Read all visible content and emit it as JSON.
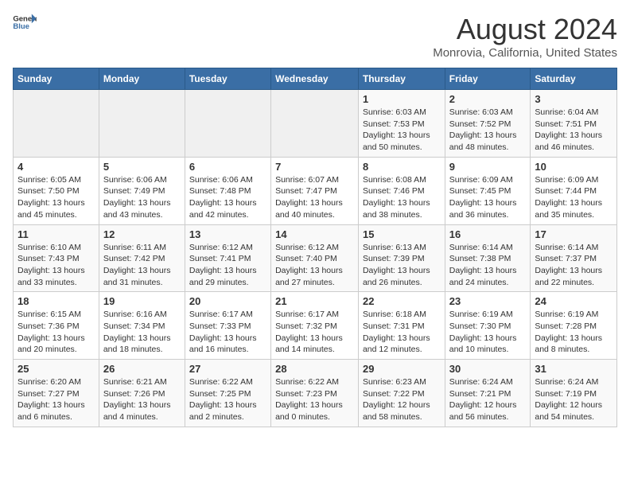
{
  "header": {
    "logo_general": "General",
    "logo_blue": "Blue",
    "month_title": "August 2024",
    "location": "Monrovia, California, United States"
  },
  "calendar": {
    "weekdays": [
      "Sunday",
      "Monday",
      "Tuesday",
      "Wednesday",
      "Thursday",
      "Friday",
      "Saturday"
    ],
    "weeks": [
      [
        {
          "day": "",
          "info": ""
        },
        {
          "day": "",
          "info": ""
        },
        {
          "day": "",
          "info": ""
        },
        {
          "day": "",
          "info": ""
        },
        {
          "day": "1",
          "info": "Sunrise: 6:03 AM\nSunset: 7:53 PM\nDaylight: 13 hours and 50 minutes."
        },
        {
          "day": "2",
          "info": "Sunrise: 6:03 AM\nSunset: 7:52 PM\nDaylight: 13 hours and 48 minutes."
        },
        {
          "day": "3",
          "info": "Sunrise: 6:04 AM\nSunset: 7:51 PM\nDaylight: 13 hours and 46 minutes."
        }
      ],
      [
        {
          "day": "4",
          "info": "Sunrise: 6:05 AM\nSunset: 7:50 PM\nDaylight: 13 hours and 45 minutes."
        },
        {
          "day": "5",
          "info": "Sunrise: 6:06 AM\nSunset: 7:49 PM\nDaylight: 13 hours and 43 minutes."
        },
        {
          "day": "6",
          "info": "Sunrise: 6:06 AM\nSunset: 7:48 PM\nDaylight: 13 hours and 42 minutes."
        },
        {
          "day": "7",
          "info": "Sunrise: 6:07 AM\nSunset: 7:47 PM\nDaylight: 13 hours and 40 minutes."
        },
        {
          "day": "8",
          "info": "Sunrise: 6:08 AM\nSunset: 7:46 PM\nDaylight: 13 hours and 38 minutes."
        },
        {
          "day": "9",
          "info": "Sunrise: 6:09 AM\nSunset: 7:45 PM\nDaylight: 13 hours and 36 minutes."
        },
        {
          "day": "10",
          "info": "Sunrise: 6:09 AM\nSunset: 7:44 PM\nDaylight: 13 hours and 35 minutes."
        }
      ],
      [
        {
          "day": "11",
          "info": "Sunrise: 6:10 AM\nSunset: 7:43 PM\nDaylight: 13 hours and 33 minutes."
        },
        {
          "day": "12",
          "info": "Sunrise: 6:11 AM\nSunset: 7:42 PM\nDaylight: 13 hours and 31 minutes."
        },
        {
          "day": "13",
          "info": "Sunrise: 6:12 AM\nSunset: 7:41 PM\nDaylight: 13 hours and 29 minutes."
        },
        {
          "day": "14",
          "info": "Sunrise: 6:12 AM\nSunset: 7:40 PM\nDaylight: 13 hours and 27 minutes."
        },
        {
          "day": "15",
          "info": "Sunrise: 6:13 AM\nSunset: 7:39 PM\nDaylight: 13 hours and 26 minutes."
        },
        {
          "day": "16",
          "info": "Sunrise: 6:14 AM\nSunset: 7:38 PM\nDaylight: 13 hours and 24 minutes."
        },
        {
          "day": "17",
          "info": "Sunrise: 6:14 AM\nSunset: 7:37 PM\nDaylight: 13 hours and 22 minutes."
        }
      ],
      [
        {
          "day": "18",
          "info": "Sunrise: 6:15 AM\nSunset: 7:36 PM\nDaylight: 13 hours and 20 minutes."
        },
        {
          "day": "19",
          "info": "Sunrise: 6:16 AM\nSunset: 7:34 PM\nDaylight: 13 hours and 18 minutes."
        },
        {
          "day": "20",
          "info": "Sunrise: 6:17 AM\nSunset: 7:33 PM\nDaylight: 13 hours and 16 minutes."
        },
        {
          "day": "21",
          "info": "Sunrise: 6:17 AM\nSunset: 7:32 PM\nDaylight: 13 hours and 14 minutes."
        },
        {
          "day": "22",
          "info": "Sunrise: 6:18 AM\nSunset: 7:31 PM\nDaylight: 13 hours and 12 minutes."
        },
        {
          "day": "23",
          "info": "Sunrise: 6:19 AM\nSunset: 7:30 PM\nDaylight: 13 hours and 10 minutes."
        },
        {
          "day": "24",
          "info": "Sunrise: 6:19 AM\nSunset: 7:28 PM\nDaylight: 13 hours and 8 minutes."
        }
      ],
      [
        {
          "day": "25",
          "info": "Sunrise: 6:20 AM\nSunset: 7:27 PM\nDaylight: 13 hours and 6 minutes."
        },
        {
          "day": "26",
          "info": "Sunrise: 6:21 AM\nSunset: 7:26 PM\nDaylight: 13 hours and 4 minutes."
        },
        {
          "day": "27",
          "info": "Sunrise: 6:22 AM\nSunset: 7:25 PM\nDaylight: 13 hours and 2 minutes."
        },
        {
          "day": "28",
          "info": "Sunrise: 6:22 AM\nSunset: 7:23 PM\nDaylight: 13 hours and 0 minutes."
        },
        {
          "day": "29",
          "info": "Sunrise: 6:23 AM\nSunset: 7:22 PM\nDaylight: 12 hours and 58 minutes."
        },
        {
          "day": "30",
          "info": "Sunrise: 6:24 AM\nSunset: 7:21 PM\nDaylight: 12 hours and 56 minutes."
        },
        {
          "day": "31",
          "info": "Sunrise: 6:24 AM\nSunset: 7:19 PM\nDaylight: 12 hours and 54 minutes."
        }
      ]
    ]
  }
}
